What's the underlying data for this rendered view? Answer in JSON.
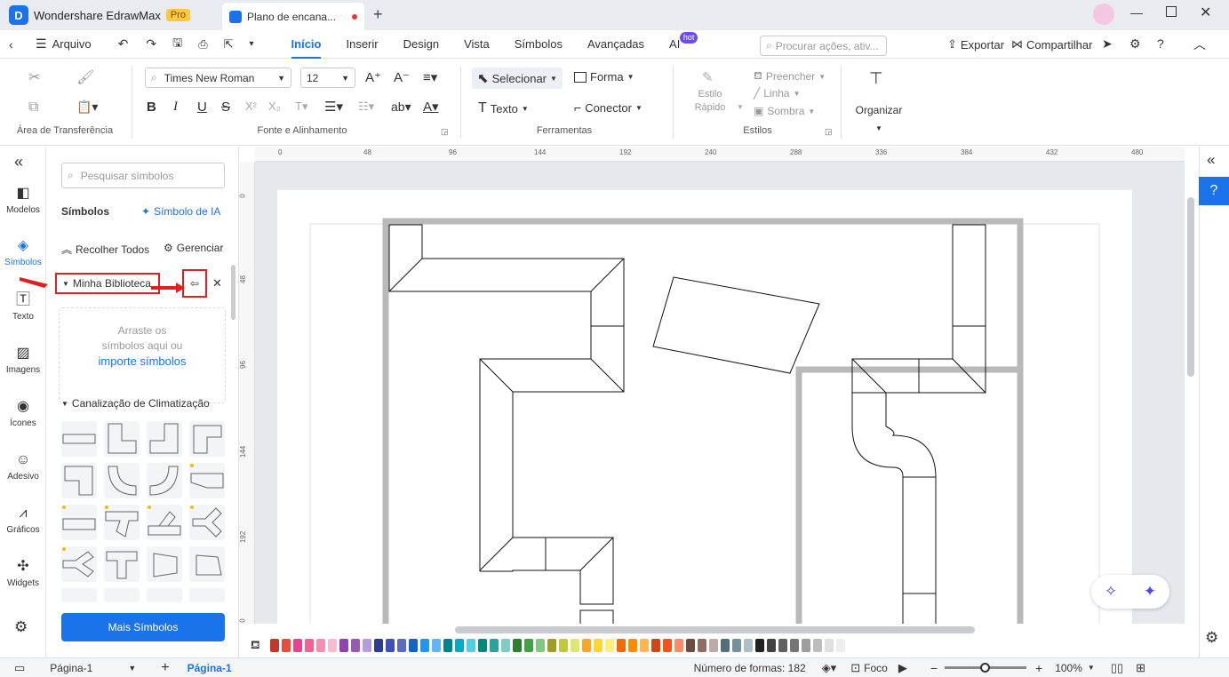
{
  "app": {
    "name": "Wondershare EdrawMax",
    "badge": "Pro",
    "doc_tab": "Plano de encana..."
  },
  "menu": {
    "file": "Arquivo",
    "tabs": [
      "Início",
      "Inserir",
      "Design",
      "Vista",
      "Símbolos",
      "Avançadas",
      "AI"
    ],
    "hot": "hot",
    "search_placeholder": "Procurar ações, ativ...",
    "export": "Exportar",
    "share": "Compartilhar"
  },
  "ribbon": {
    "clipboard_label": "Área de Transferência",
    "font_name": "Times New Roman",
    "font_size": "12",
    "font_label": "Fonte e Alinhamento",
    "select": "Selecionar",
    "shape": "Forma",
    "text": "Texto",
    "connector": "Conector",
    "tools_label": "Ferramentas",
    "quick_style_1": "Estilo",
    "quick_style_2": "Rápido",
    "fill": "Preencher",
    "line": "Linha",
    "shadow": "Sombra",
    "styles_label": "Estilos",
    "organize": "Organizar"
  },
  "leftnav": [
    "Modelos",
    "Símbolos",
    "Texto",
    "Imagens",
    "Ícones",
    "Adesivo",
    "Gráficos",
    "Widgets"
  ],
  "panel": {
    "search_placeholder": "Pesquisar símbolos",
    "title": "Símbolos",
    "ai_symbol": "Símbolo de IA",
    "collapse": "Recolher Todos",
    "manage": "Gerenciar",
    "my_library": "Minha Biblioteca",
    "drop_1": "Arraste os",
    "drop_2": "símbolos aqui ou",
    "import": "importe símbolos",
    "category": "Canalização de Climatização",
    "more": "Mais Símbolos"
  },
  "ruler": {
    "h": [
      "0",
      "48",
      "96",
      "144",
      "192",
      "240",
      "288",
      "336",
      "384",
      "432",
      "480"
    ],
    "v": [
      "0",
      "48",
      "96",
      "144",
      "192",
      "0"
    ]
  },
  "colors": [
    "#c0392b",
    "#e74c3c",
    "#e84393",
    "#f06292",
    "#f48fb1",
    "#f8bbd0",
    "#8e44ad",
    "#9b59b6",
    "#b39ddb",
    "#2c3e8f",
    "#3f51b5",
    "#5c6bc0",
    "#1565c0",
    "#2196f3",
    "#64b5f6",
    "#00838f",
    "#00acc1",
    "#4dd0e1",
    "#00897b",
    "#26a69a",
    "#80cbc4",
    "#2e7d32",
    "#43a047",
    "#81c784",
    "#9e9d24",
    "#c0ca33",
    "#dce775",
    "#f9a825",
    "#fdd835",
    "#fff176",
    "#ef6c00",
    "#fb8c00",
    "#ffb74d",
    "#d84315",
    "#f4511e",
    "#ff8a65",
    "#6d4c41",
    "#8d6e63",
    "#bcaaa4",
    "#546e7a",
    "#78909c",
    "#b0bec5",
    "#212121",
    "#424242",
    "#616161",
    "#757575",
    "#9e9e9e",
    "#bdbdbd",
    "#e0e0e0",
    "#eeeeee"
  ],
  "status": {
    "page_select": "Página-1",
    "page_tab": "Página-1",
    "shape_count": "Número de formas: 182",
    "focus": "Foco",
    "zoom": "100%"
  }
}
